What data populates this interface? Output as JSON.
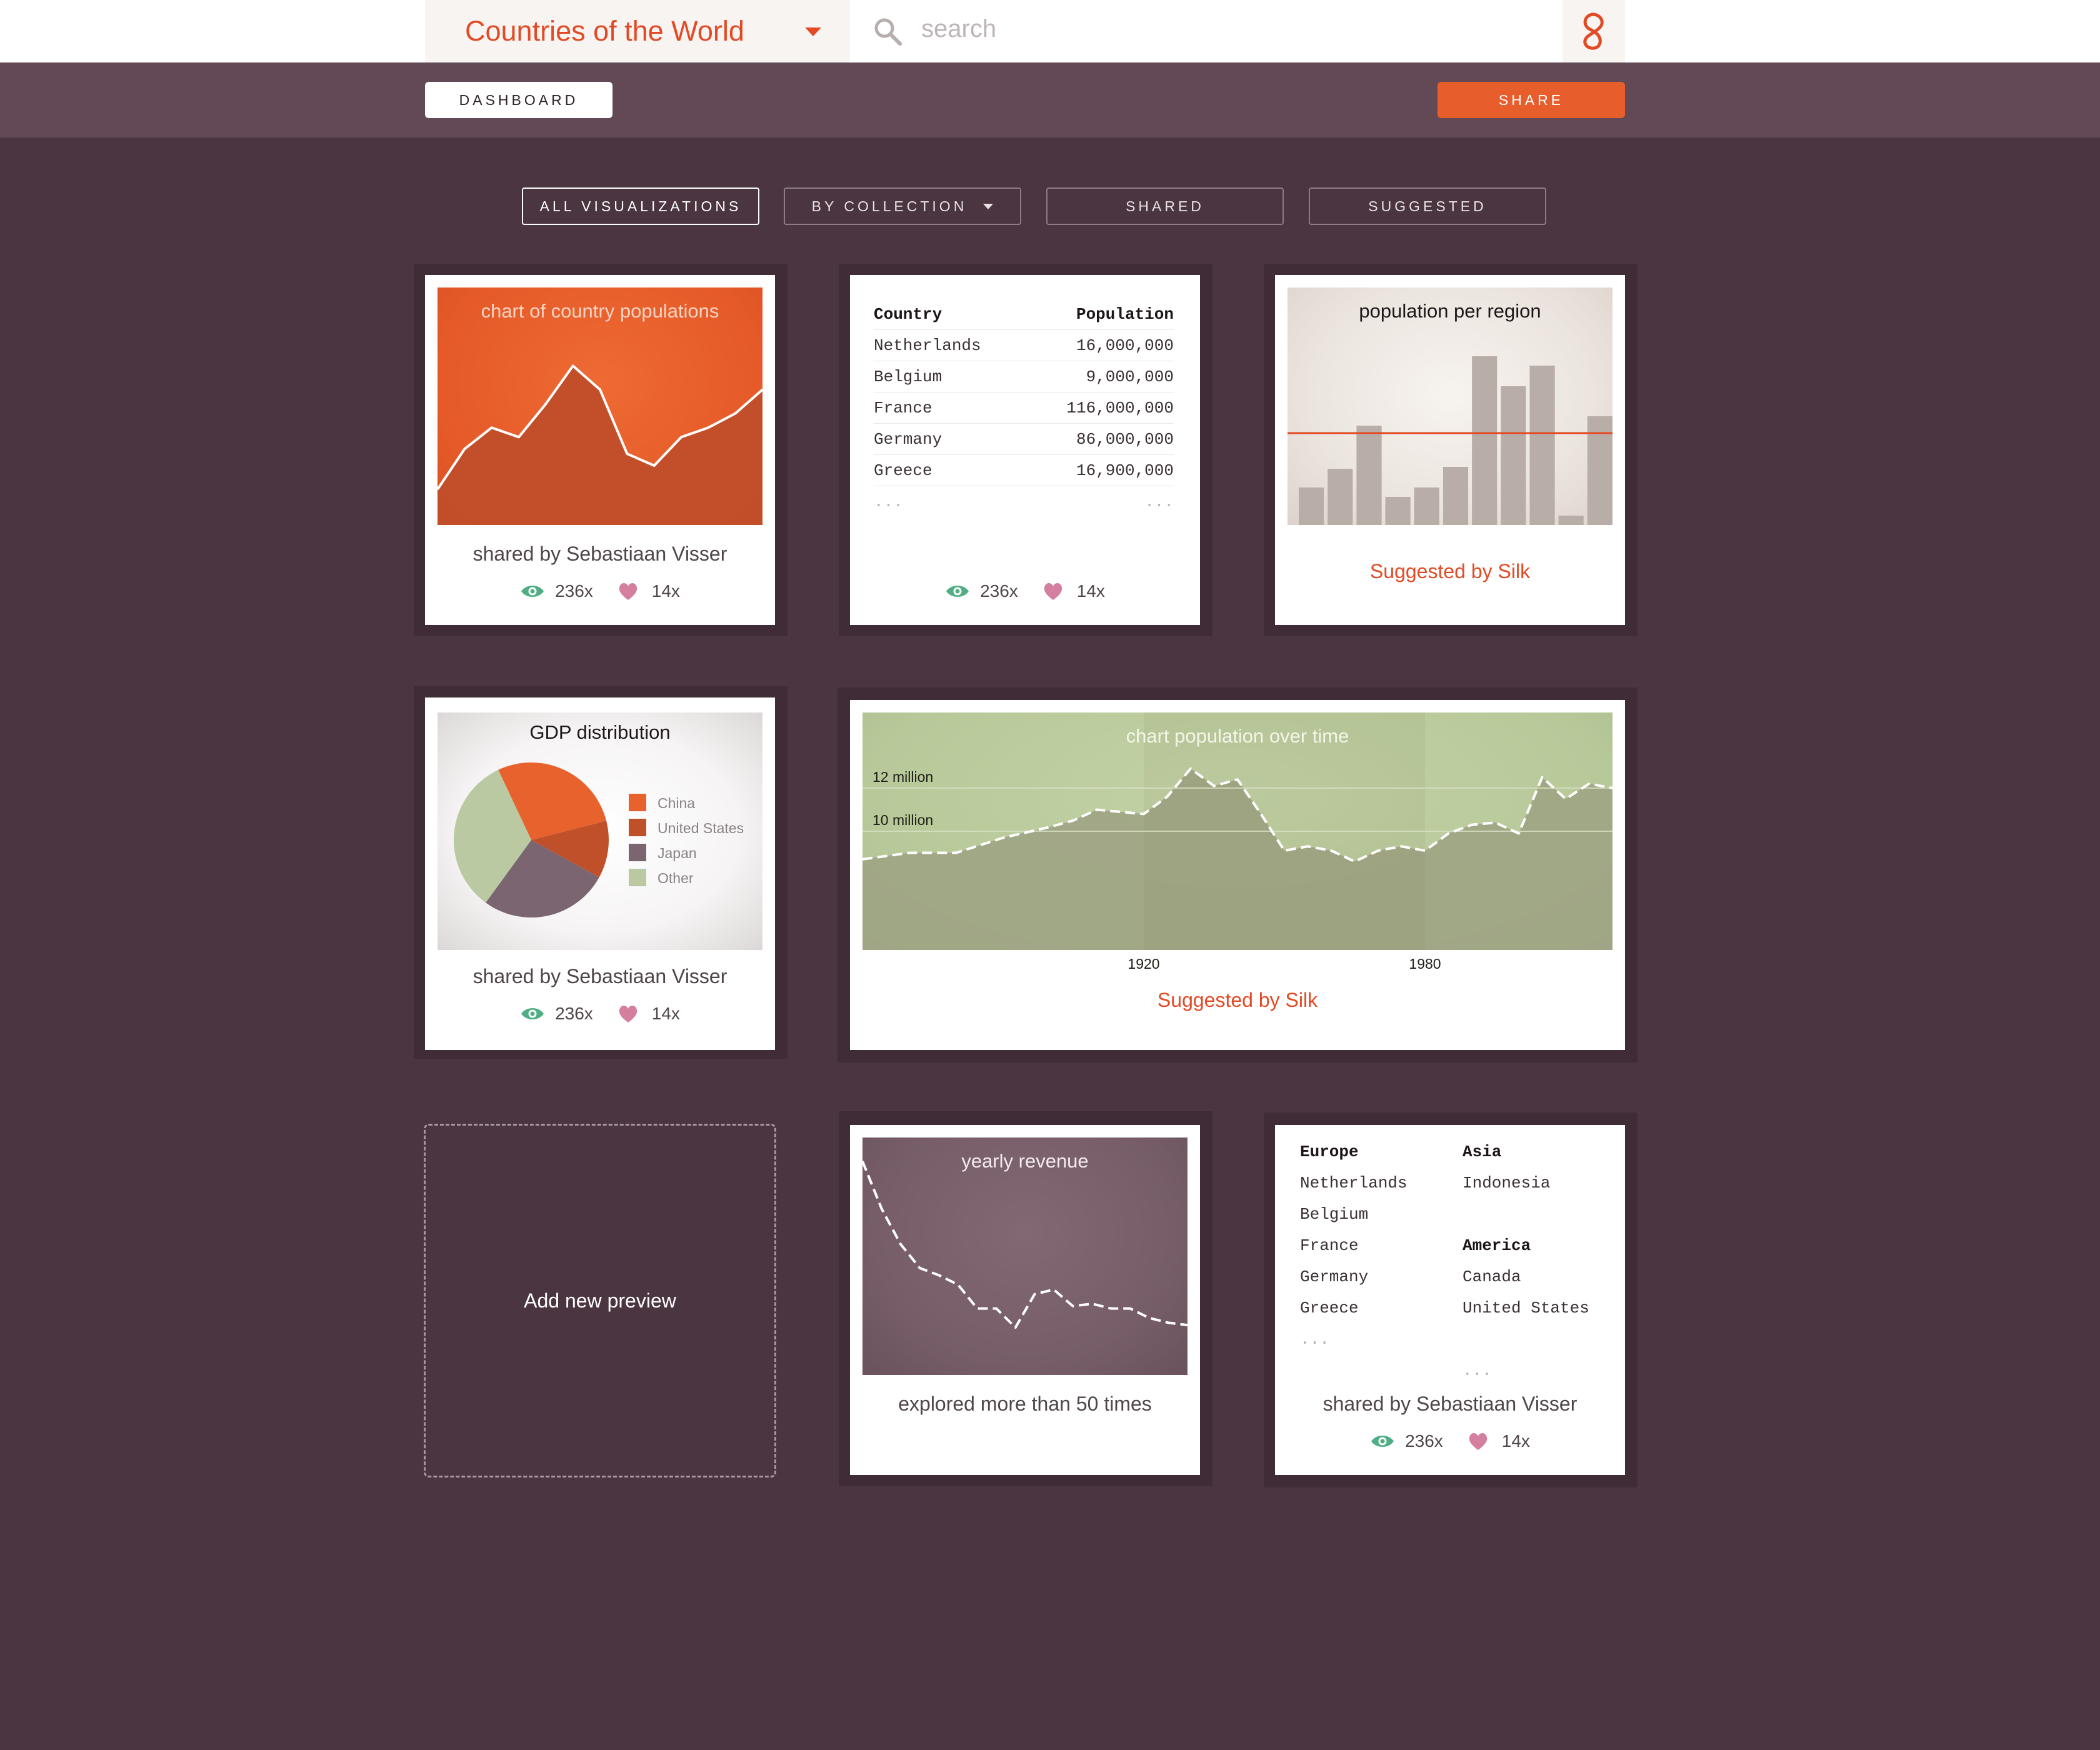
{
  "header": {
    "title": "Countries of the World",
    "search_placeholder": "search"
  },
  "subbar": {
    "dashboard_label": "DASHBOARD",
    "share_label": "SHARE"
  },
  "tabs": [
    {
      "label": "ALL VISUALIZATIONS",
      "active": true
    },
    {
      "label": "BY COLLECTION",
      "active": false
    },
    {
      "label": "SHARED",
      "active": false
    },
    {
      "label": "SUGGESTED",
      "active": false
    }
  ],
  "colors": {
    "accent": "#e85d2c",
    "brand_red": "#e24a25",
    "eye": "#4fae84",
    "heart": "#d47f9f",
    "background": "#4a3540"
  },
  "cards": {
    "country_populations": {
      "title": "chart of country populations",
      "caption": "shared by Sebastiaan Visser",
      "views": "236x",
      "likes": "14x"
    },
    "population_table": {
      "headers": [
        "Country",
        "Population"
      ],
      "rows": [
        [
          "Netherlands",
          "16,000,000"
        ],
        [
          "Belgium",
          "9,000,000"
        ],
        [
          "France",
          "116,000,000"
        ],
        [
          "Germany",
          "86,000,000"
        ],
        [
          "Greece",
          "16,900,000"
        ]
      ],
      "more_left": "...",
      "more_right": "...",
      "views": "236x",
      "likes": "14x"
    },
    "population_per_region": {
      "title": "population per region",
      "caption": "Suggested by Silk"
    },
    "gdp_distribution": {
      "title": "GDP distribution",
      "caption": "shared by Sebastiaan Visser",
      "views": "236x",
      "likes": "14x"
    },
    "population_over_time": {
      "title": "chart population over time",
      "caption": "Suggested by Silk"
    },
    "yearly_revenue": {
      "title": "yearly revenue",
      "caption": "explored more than 50 times"
    },
    "add_preview": {
      "label": "Add new preview"
    },
    "regions": {
      "columns": [
        {
          "items": [
            {
              "heading": "Europe",
              "entries": [
                "Netherlands",
                "Belgium",
                "France",
                "Germany",
                "Greece"
              ]
            }
          ]
        },
        {
          "items": [
            {
              "heading": "Asia",
              "entries": [
                "Indonesia"
              ]
            },
            {
              "heading": "America",
              "entries": [
                "Canada",
                "United States"
              ]
            }
          ]
        }
      ],
      "more": "...",
      "caption": "shared by Sebastiaan Visser",
      "views": "236x",
      "likes": "14x"
    }
  },
  "chart_data": [
    {
      "type": "area",
      "title": "chart of country populations",
      "x": [
        0,
        1,
        2,
        3,
        4,
        5,
        6,
        7,
        8,
        9,
        10,
        11,
        12
      ],
      "values": [
        15,
        32,
        41,
        37,
        51,
        67,
        57,
        30,
        25,
        37,
        41,
        47,
        57
      ],
      "ylim": [
        0,
        100
      ],
      "grid": false,
      "color": "#c04e2a"
    },
    {
      "type": "bar",
      "title": "population per region",
      "values": [
        20,
        30,
        53,
        15,
        20,
        31,
        90,
        74,
        85,
        5,
        58
      ],
      "reference_line": 49,
      "ylim": [
        0,
        100
      ],
      "colors": {
        "bar": "#b9ada8",
        "line": "#e24a25"
      }
    },
    {
      "type": "pie",
      "title": "GDP distribution",
      "slices": [
        {
          "label": "China",
          "value": 28,
          "color": "#e8622e"
        },
        {
          "label": "United States",
          "value": 12,
          "color": "#c0502a"
        },
        {
          "label": "Japan",
          "value": 27,
          "color": "#7b6570"
        },
        {
          "label": "Other",
          "value": 33,
          "color": "#bac9a2"
        }
      ]
    },
    {
      "type": "area",
      "title": "chart population over time",
      "x": [
        1860,
        1870,
        1880,
        1890,
        1900,
        1905,
        1910,
        1920,
        1925,
        1930,
        1935,
        1940,
        1945,
        1950,
        1955,
        1960,
        1965,
        1970,
        1975,
        1980,
        1985,
        1990,
        1995,
        2000,
        2005,
        2010,
        2015,
        2020
      ],
      "values": [
        8.7,
        9.0,
        9.0,
        9.7,
        10.2,
        10.5,
        11.0,
        10.8,
        11.6,
        12.9,
        12.1,
        12.4,
        10.8,
        9.1,
        9.3,
        9.1,
        8.6,
        9.1,
        9.3,
        9.1,
        9.9,
        10.3,
        10.4,
        9.9,
        12.5,
        11.5,
        12.2,
        12.0
      ],
      "xticks": [
        "1920",
        "1980"
      ],
      "yticks": [
        "10 million",
        "12 million"
      ],
      "ylim": [
        4.5,
        15.5
      ],
      "grid": true
    },
    {
      "type": "line",
      "title": "yearly revenue",
      "x": [
        0,
        1,
        2,
        3,
        4,
        5,
        6,
        7,
        8,
        9,
        10,
        11,
        12,
        13,
        14,
        15,
        16,
        17
      ],
      "values": [
        90,
        70,
        55,
        45,
        42,
        38,
        28,
        28,
        20,
        34,
        36,
        29,
        30,
        28,
        28,
        24,
        22,
        21
      ],
      "ylim": [
        0,
        100
      ],
      "style": "dashed"
    }
  ]
}
